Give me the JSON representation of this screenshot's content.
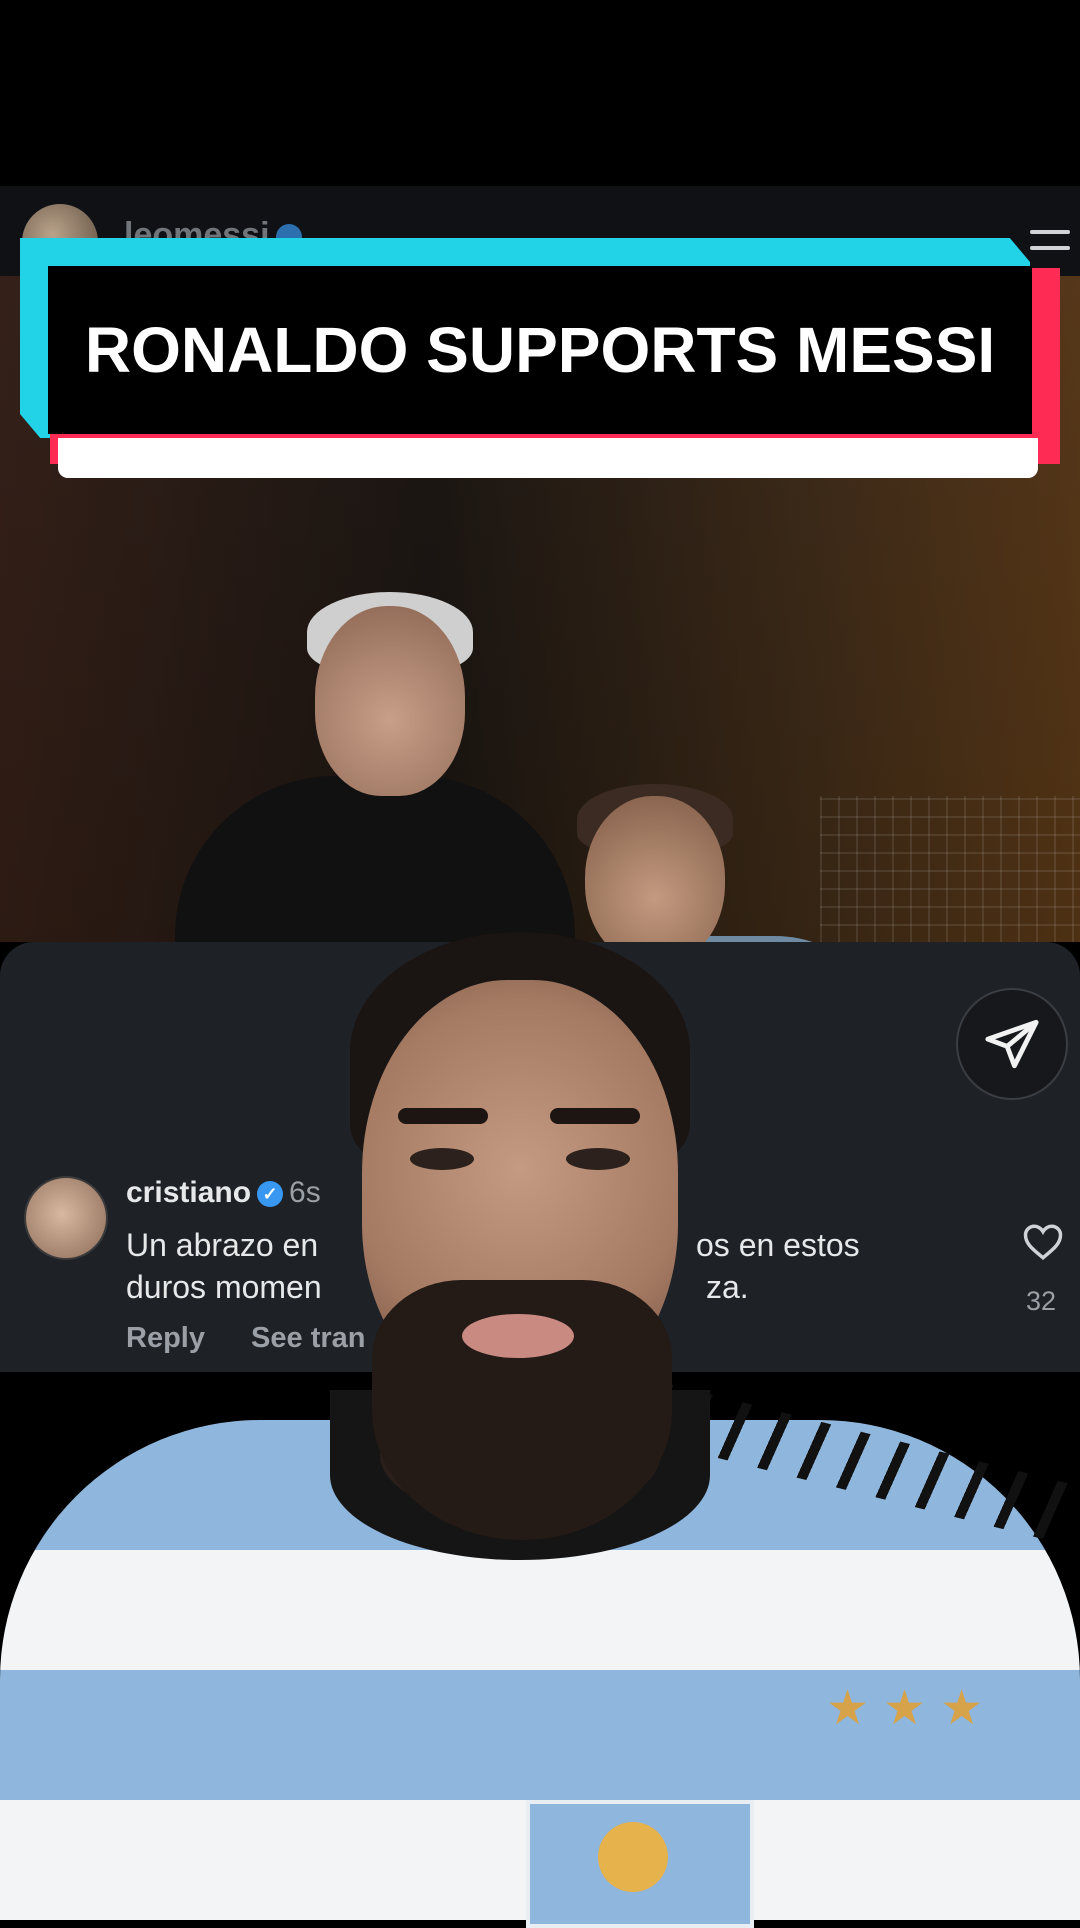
{
  "post": {
    "username": "leomessi"
  },
  "banner": {
    "title": "RONALDO SUPPORTS MESSI"
  },
  "comment": {
    "username": "cristiano",
    "time": "6s",
    "text_left_line1": "Un abrazo en",
    "text_right_line1": "os en estos",
    "text_left_line2": "duros momen",
    "text_right_line2": "za.",
    "reply_label": "Reply",
    "translate_label": "See tran",
    "likes": "32"
  },
  "colors": {
    "banner_cyan": "#22d3e8",
    "banner_red": "#fe2c55",
    "panel_bg": "#1e2126",
    "verified_blue": "#3897f0"
  },
  "icons": [
    "verified-icon",
    "menu-icon",
    "share-icon",
    "heart-icon"
  ]
}
